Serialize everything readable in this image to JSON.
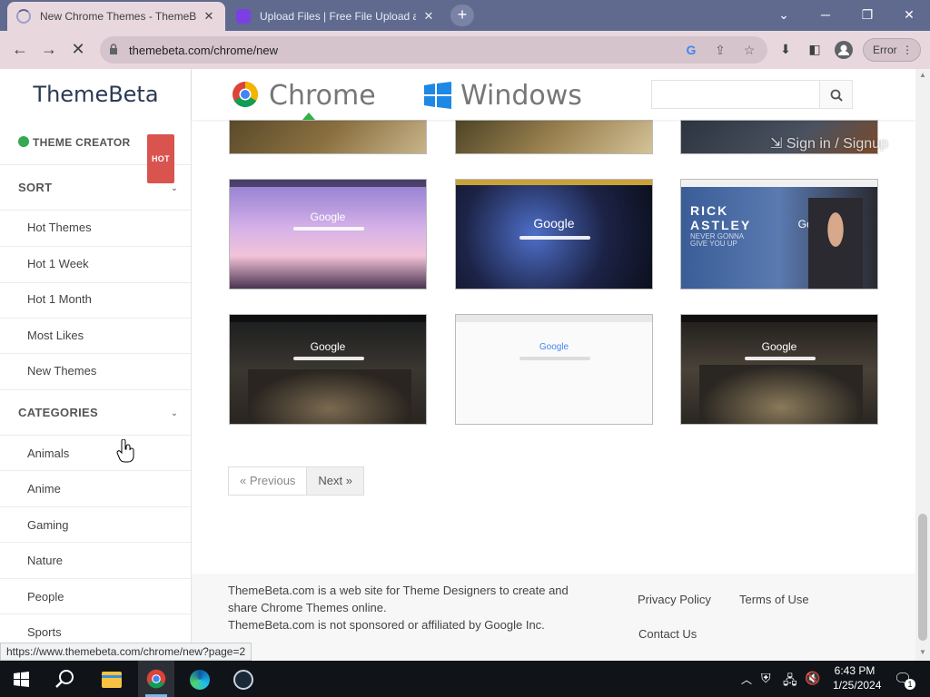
{
  "browser": {
    "tabs": [
      {
        "title": "New Chrome Themes - ThemeBeta",
        "active": true
      },
      {
        "title": "Upload Files | Free File Upload and",
        "active": false
      }
    ],
    "url": "themebeta.com/chrome/new",
    "error_label": "Error",
    "status_url": "https://www.themebeta.com/chrome/new?page=2"
  },
  "site": {
    "logo": "ThemeBeta",
    "nav": {
      "chrome": "Chrome",
      "windows": "Windows"
    },
    "signin": "Sign in / Signup",
    "search_placeholder": ""
  },
  "sidebar": {
    "theme_creator": "THEME CREATOR",
    "hot_badge": "HOT",
    "sort_heading": "SORT",
    "sort_items": [
      "Hot Themes",
      "Hot 1 Week",
      "Hot 1 Month",
      "Most Likes",
      "New Themes"
    ],
    "categories_heading": "CATEGORIES",
    "category_items": [
      "Animals",
      "Anime",
      "Gaming",
      "Nature",
      "People",
      "Sports"
    ]
  },
  "themes": {
    "google_text": "Google",
    "rick_text": {
      "line1": "RICK",
      "line2": "ASTLEY",
      "line3": "NEVER GONNA",
      "line4": "GIVE YOU UP"
    }
  },
  "pager": {
    "previous": "« Previous",
    "next": "Next »"
  },
  "footer": {
    "line1": "ThemeBeta.com is a web site for Theme Designers to create and",
    "line2": "share Chrome Themes online.",
    "line3": "ThemeBeta.com is not sponsored or affiliated by Google Inc.",
    "privacy": "Privacy Policy",
    "terms": "Terms of Use",
    "contact": "Contact Us"
  },
  "taskbar": {
    "time": "6:43 PM",
    "date": "1/25/2024",
    "notif_count": "1"
  },
  "colors": {
    "accent": "#2b3a55",
    "hot": "#d9534f",
    "chrome_green": "#34a853"
  }
}
